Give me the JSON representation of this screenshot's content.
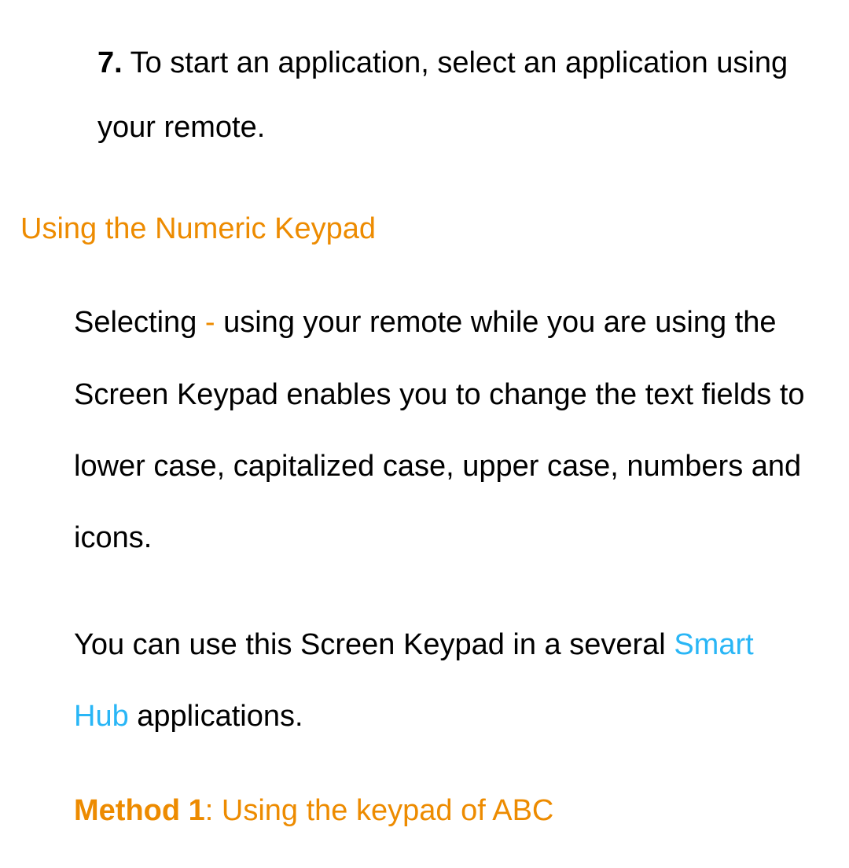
{
  "step7": {
    "number": "7.",
    "text": "To start an application, select an application using your remote."
  },
  "heading": "Using the Numeric Keypad",
  "paragraph1": {
    "part1": "Selecting ",
    "dash": "-",
    "part2": " using your remote while you are using the Screen Keypad enables you to change the text fields to lower case, capitalized case, upper case, numbers and icons."
  },
  "paragraph2": {
    "part1": "You can use this Screen Keypad in a several ",
    "highlighted": "Smart Hub",
    "part2": " applications."
  },
  "method1": {
    "label": "Method 1",
    "colon": ": ",
    "text": "Using the keypad of ABC"
  }
}
